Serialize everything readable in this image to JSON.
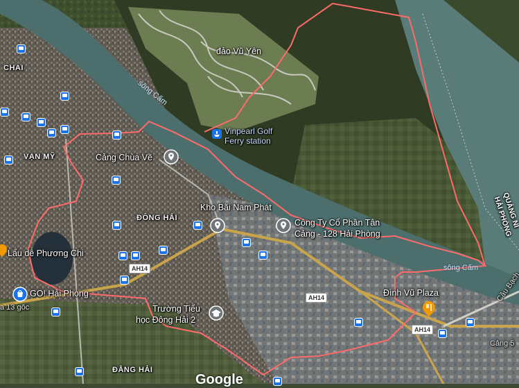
{
  "map": {
    "labels": {
      "dao_vu_yen": "đảo Vũ Yên",
      "song_cam_1": "sông Cấm",
      "song_cam_2": "sông Cấm",
      "vinpearl": "Vinpearl Golf",
      "ferry": "Ferry station",
      "cang_chua_ve": "Cảng Chùa Vẽ",
      "van_my": "VẠN MỸ",
      "chai": "CHAI",
      "dong_hai": "ĐÔNG HẢI",
      "kho_bai": "Kho Bãi Nam Phát",
      "cong_ty": "Công Ty Cổ Phần Tân",
      "cong_ty_2": "Cảng - 128 Hải Phòng",
      "lau_de": "Lẩu dê Phương Chi",
      "go_hai_phong": "GO! Hải Phòng",
      "nga_13": "a 13 gốc",
      "truong_tieu": "Trường Tiểu",
      "truong_tieu_2": "học Đông Hải 2",
      "dinh_vu": "Đình Vũ Plaza",
      "dang_hai": "ĐẰNG HẢI",
      "quang_ninh": "QUẢNG NI",
      "hai_phong_vert": "HẢI PHÒNG",
      "cau_bach": "Cầu Bạch",
      "cang_5": "Cảng 5",
      "google": "Google"
    },
    "highway": [
      "AH14",
      "AH14",
      "AH14"
    ],
    "colors": {
      "boundary": "#ff6b6b",
      "pin": "#70757a",
      "food_pin": "#f29900",
      "bus": "#1a73e8"
    },
    "icons": [
      "place-pin-icon",
      "food-pin-icon",
      "shopping-pin-icon",
      "school-pin-icon",
      "ferry-icon",
      "bus-stop-icon"
    ]
  }
}
